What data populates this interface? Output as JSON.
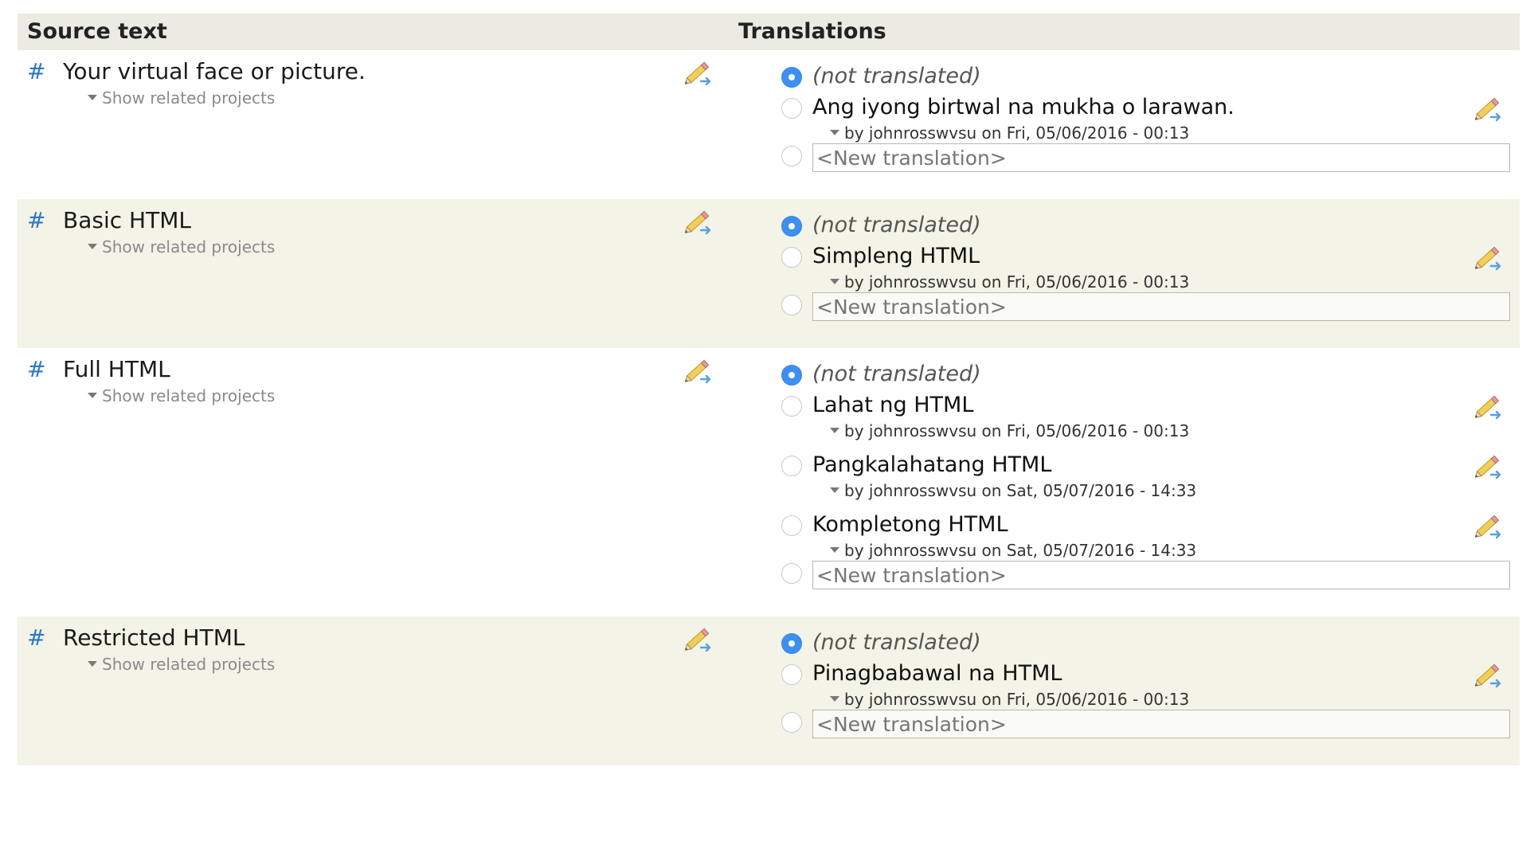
{
  "header": {
    "source_label": "Source text",
    "translations_label": "Translations"
  },
  "icons": {
    "hash": "hash-link",
    "edit": "pencil-edit-icon",
    "expand": "caret-down-icon"
  },
  "colors": {
    "header_bg": "#ebebe3",
    "alt_row_bg": "#f3f3e7",
    "link": "#2b78c2",
    "radio_selected": "#3d8ff0"
  },
  "rows": [
    {
      "hash": "#",
      "source": "Your virtual face or picture.",
      "related": "Show related projects",
      "not_translated": "(not translated)",
      "translations": [
        {
          "text": "Ang iyong birtwal na mukha o larawan.",
          "byline": "by johnrosswvsu on Fri, 05/06/2016 - 00:13"
        }
      ],
      "new_placeholder": "<New translation>"
    },
    {
      "hash": "#",
      "source": "Basic HTML",
      "related": "Show related projects",
      "not_translated": "(not translated)",
      "translations": [
        {
          "text": "Simpleng HTML",
          "byline": "by johnrosswvsu on Fri, 05/06/2016 - 00:13"
        }
      ],
      "new_placeholder": "<New translation>"
    },
    {
      "hash": "#",
      "source": "Full HTML",
      "related": "Show related projects",
      "not_translated": "(not translated)",
      "translations": [
        {
          "text": "Lahat ng HTML",
          "byline": "by johnrosswvsu on Fri, 05/06/2016 - 00:13"
        },
        {
          "text": "Pangkalahatang HTML",
          "byline": "by johnrosswvsu on Sat, 05/07/2016 - 14:33"
        },
        {
          "text": "Kompletong HTML",
          "byline": "by johnrosswvsu on Sat, 05/07/2016 - 14:33"
        }
      ],
      "new_placeholder": "<New translation>"
    },
    {
      "hash": "#",
      "source": "Restricted HTML",
      "related": "Show related projects",
      "not_translated": "(not translated)",
      "translations": [
        {
          "text": "Pinagbabawal na HTML",
          "byline": "by johnrosswvsu on Fri, 05/06/2016 - 00:13"
        }
      ],
      "new_placeholder": "<New translation>"
    }
  ]
}
